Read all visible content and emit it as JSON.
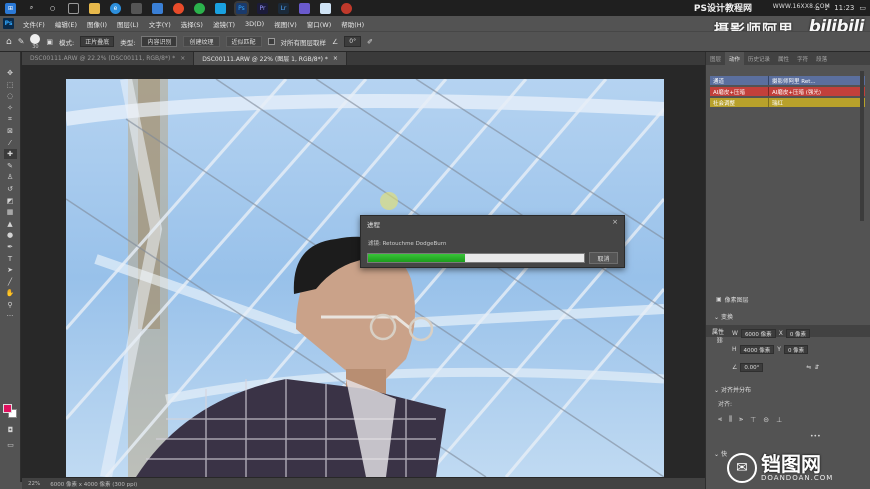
{
  "taskbar": {
    "icons": [
      "search-icon",
      "cortana-icon",
      "task-view-icon",
      "folder-icon",
      "edge-icon",
      "store-icon",
      "mail-icon",
      "browser-icon",
      "wechat-icon",
      "app-icon",
      "photoshop-icon",
      "premiere-icon",
      "lightroom-icon",
      "media-icon",
      "finder-icon",
      "disc-icon"
    ],
    "watermark": "PS设计教程网",
    "url": "WWW.16XX8.COM",
    "time": "11:23"
  },
  "menubar": {
    "logo": "Ps",
    "items": [
      "文件(F)",
      "编辑(E)",
      "图像(I)",
      "图层(L)",
      "文字(Y)",
      "选择(S)",
      "滤镜(T)",
      "3D(D)",
      "视图(V)",
      "窗口(W)",
      "帮助(H)"
    ],
    "brand": "摄影师阿里",
    "bilibili": "bilibili"
  },
  "options": {
    "brush_size": "30",
    "mode_label": "模式:",
    "mode_value": "正片叠底",
    "type_label": "类型:",
    "type_buttons": [
      "内容识别",
      "创建纹理",
      "近似匹配"
    ],
    "sample_all": "对所有图层取样",
    "angle": "0°"
  },
  "tabs": [
    {
      "label": "DSC00111.ARW @ 22.2% (DSC00111, RGB/8*) *"
    },
    {
      "label": "DSC00111.ARW @ 22% (图层 1, RGB/8*) *"
    }
  ],
  "dialog": {
    "title": "进程",
    "text": "滤镜: Retouchme DodgeBurn",
    "progress": 0.45,
    "cancel": "取消",
    "close": "×"
  },
  "panels": {
    "top_tabs": [
      "图层",
      "动作",
      "历史记录",
      "属性",
      "字符",
      "段落"
    ],
    "active_tab": "动作",
    "actions": [
      {
        "left": "通道",
        "right": "摄影师阿里 Ret..."
      },
      {
        "left": "AI磨皮+压暗",
        "right": "AI磨皮+压暗 (强光)"
      },
      {
        "left": "社会调整",
        "right": "瑞红"
      }
    ],
    "properties_title": "属性",
    "layer_type": "像素图层",
    "transform_title": "变换",
    "w": "6000 像素",
    "x": "0 像素",
    "h": "4000 像素",
    "y": "0 像素",
    "angle": "0.00°",
    "align_title": "对齐并分布",
    "align_sub": "对齐:",
    "more": "•••",
    "bottom_label": "快"
  },
  "statusbar": {
    "zoom": "22%",
    "info": "6000 像素 x 4000 像素 (300 ppi)"
  },
  "watermark": {
    "cn": "铛图网",
    "url": "DOANDOAN.COM"
  },
  "colors": {
    "foreground": "#e0115f",
    "background": "#ffffff",
    "progress": "#22a822"
  }
}
